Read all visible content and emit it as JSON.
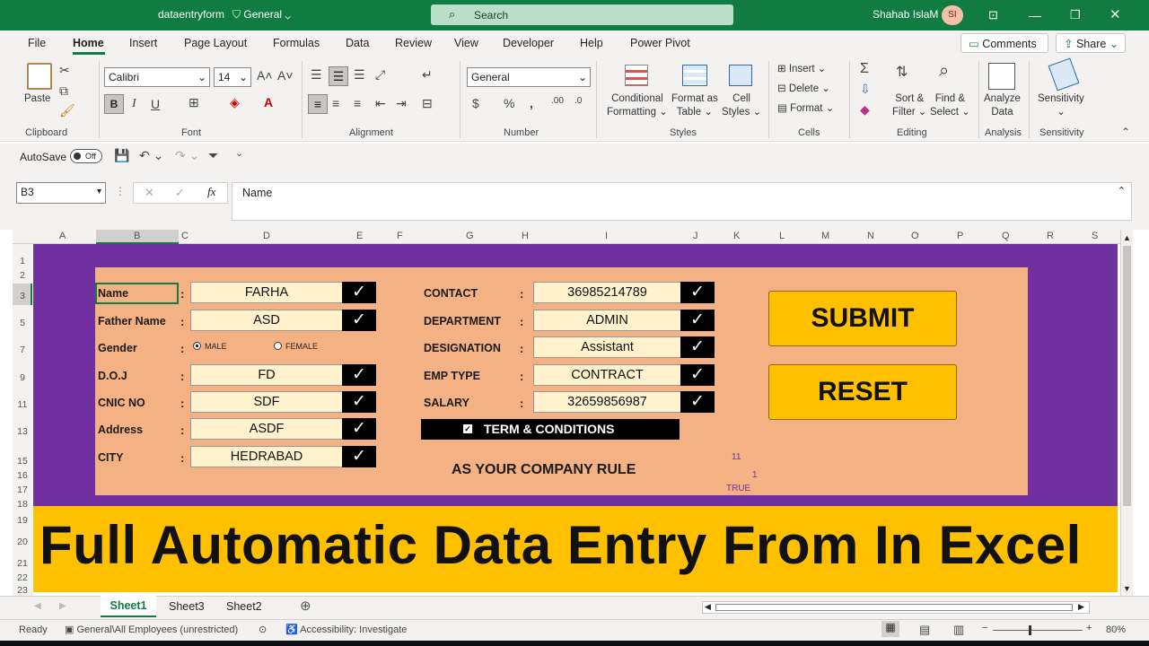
{
  "titlebar": {
    "filename": "dataentryform",
    "label": "General",
    "search": "Search",
    "user": "Shahab IslaM",
    "initials": "SI"
  },
  "tabs": [
    "File",
    "Home",
    "Insert",
    "Page Layout",
    "Formulas",
    "Data",
    "Review",
    "View",
    "Developer",
    "Help",
    "Power Pivot"
  ],
  "tabbar": {
    "comments": "Comments",
    "share": "Share"
  },
  "ribbon": {
    "paste": "Paste",
    "font_name": "Calibri",
    "font_size": "14",
    "number_format": "General",
    "conditional": "Conditional",
    "formatting": "Formatting",
    "format_as": "Format as",
    "table": "Table",
    "cell": "Cell",
    "styles_btn": "Styles",
    "insert": "Insert",
    "delete": "Delete",
    "format": "Format",
    "sort": "Sort &",
    "filter": "Filter",
    "find": "Find &",
    "select": "Select",
    "analyze": "Analyze",
    "data": "Data",
    "sensitivity": "Sensitivity",
    "groups": {
      "clipboard": "Clipboard",
      "font": "Font",
      "alignment": "Alignment",
      "number": "Number",
      "styles": "Styles",
      "cells": "Cells",
      "editing": "Editing",
      "analysis": "Analysis",
      "sensitivity": "Sensitivity"
    }
  },
  "qat": {
    "autosave": "AutoSave",
    "toggle": "Off"
  },
  "formula": {
    "namebox": "B3",
    "content": "Name"
  },
  "columns": [
    "A",
    "B",
    "C",
    "D",
    "E",
    "F",
    "G",
    "H",
    "I",
    "J",
    "K",
    "L",
    "M",
    "N",
    "O",
    "P",
    "Q",
    "R",
    "S"
  ],
  "rows": [
    "1",
    "2",
    "3",
    "5",
    "7",
    "9",
    "11",
    "13",
    "15",
    "16",
    "17",
    "18",
    "19",
    "20",
    "21",
    "22",
    "23"
  ],
  "form": {
    "left": [
      {
        "label": "Name",
        "value": "FARHA"
      },
      {
        "label": "Father Name",
        "value": "ASD"
      },
      {
        "label": "Gender",
        "value": ""
      },
      {
        "label": "D.O.J",
        "value": "FD"
      },
      {
        "label": "CNIC NO",
        "value": "SDF"
      },
      {
        "label": "Address",
        "value": "ASDF"
      },
      {
        "label": "CITY",
        "value": "HEDRABAD"
      }
    ],
    "right": [
      {
        "label": "CONTACT",
        "value": "36985214789"
      },
      {
        "label": "DEPARTMENT",
        "value": "ADMIN"
      },
      {
        "label": "DESIGNATION",
        "value": "Assistant"
      },
      {
        "label": "EMP TYPE",
        "value": "CONTRACT"
      },
      {
        "label": "SALARY",
        "value": "32659856987"
      }
    ],
    "colon": ":",
    "check": "✓",
    "male": "MALE",
    "female": "FEMALE",
    "terms": "TERM & CONDITIONS",
    "rule": "AS YOUR COMPANY RULE",
    "v1": "11",
    "v2": "1",
    "v3": "TRUE",
    "submit": "SUBMIT",
    "reset": "RESET"
  },
  "banner": "Full Automatic Data Entry From In Excel",
  "sheets": [
    "Sheet1",
    "Sheet3",
    "Sheet2"
  ],
  "status": {
    "ready": "Ready",
    "sens": "General\\All Employees (unrestricted)",
    "access": "Accessibility: Investigate",
    "zoom": "80%"
  },
  "colors": {
    "excel_green": "#107c41",
    "purple": "#7030a0",
    "peach": "#f4b183",
    "yellow": "#ffc000"
  }
}
